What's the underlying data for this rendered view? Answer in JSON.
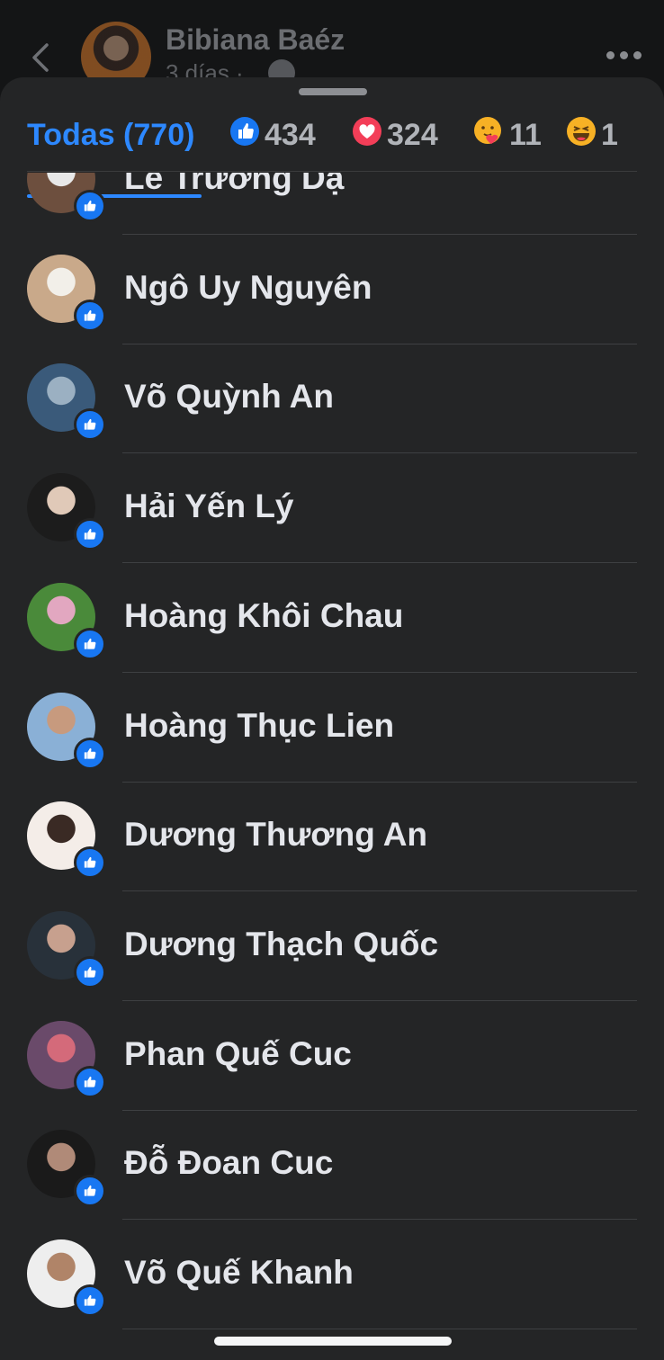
{
  "post": {
    "poster_name": "Bibiana Baéz",
    "time_ago": "3 días ·"
  },
  "tabs": [
    {
      "label": "Todas (770)",
      "icon": "none",
      "active": true
    },
    {
      "label": "434",
      "icon": "like-icon",
      "active": false
    },
    {
      "label": "324",
      "icon": "love-icon",
      "active": false
    },
    {
      "label": "11",
      "icon": "care-icon",
      "active": false
    },
    {
      "label": "1",
      "icon": "haha-icon",
      "active": false
    }
  ],
  "reactors": [
    {
      "name": "Lê Trương Dạ",
      "avatar_colors": [
        "#6d4f3e",
        "#e8e8e8"
      ]
    },
    {
      "name": "Ngô Uy Nguyên",
      "avatar_colors": [
        "#c9a98a",
        "#f2efe9"
      ]
    },
    {
      "name": "Võ Quỳnh An",
      "avatar_colors": [
        "#3a5a7a",
        "#9bb0c2"
      ]
    },
    {
      "name": "Hải Yến Lý",
      "avatar_colors": [
        "#1c1c1c",
        "#e0c9b8"
      ]
    },
    {
      "name": "Hoàng Khôi Chau",
      "avatar_colors": [
        "#4a8a3a",
        "#e2a7c0"
      ]
    },
    {
      "name": "Hoàng Thục Lien",
      "avatar_colors": [
        "#8ab0d6",
        "#c79a7e"
      ]
    },
    {
      "name": "Dương Thương An",
      "avatar_colors": [
        "#f4ede8",
        "#3a2a24"
      ]
    },
    {
      "name": "Dương Thạch Quốc",
      "avatar_colors": [
        "#28313a",
        "#c7a08e"
      ]
    },
    {
      "name": "Phan Quế Cuc",
      "avatar_colors": [
        "#6a4a6a",
        "#d46a7a"
      ]
    },
    {
      "name": "Đỗ Đoan Cuc",
      "avatar_colors": [
        "#1a1a1a",
        "#b08a78"
      ]
    },
    {
      "name": "Võ Quế Khanh",
      "avatar_colors": [
        "#eeeeee",
        "#b08468"
      ]
    }
  ],
  "colors": {
    "accent": "#2d88ff",
    "sheet_bg": "#242526",
    "like_badge": "#1877f2"
  }
}
